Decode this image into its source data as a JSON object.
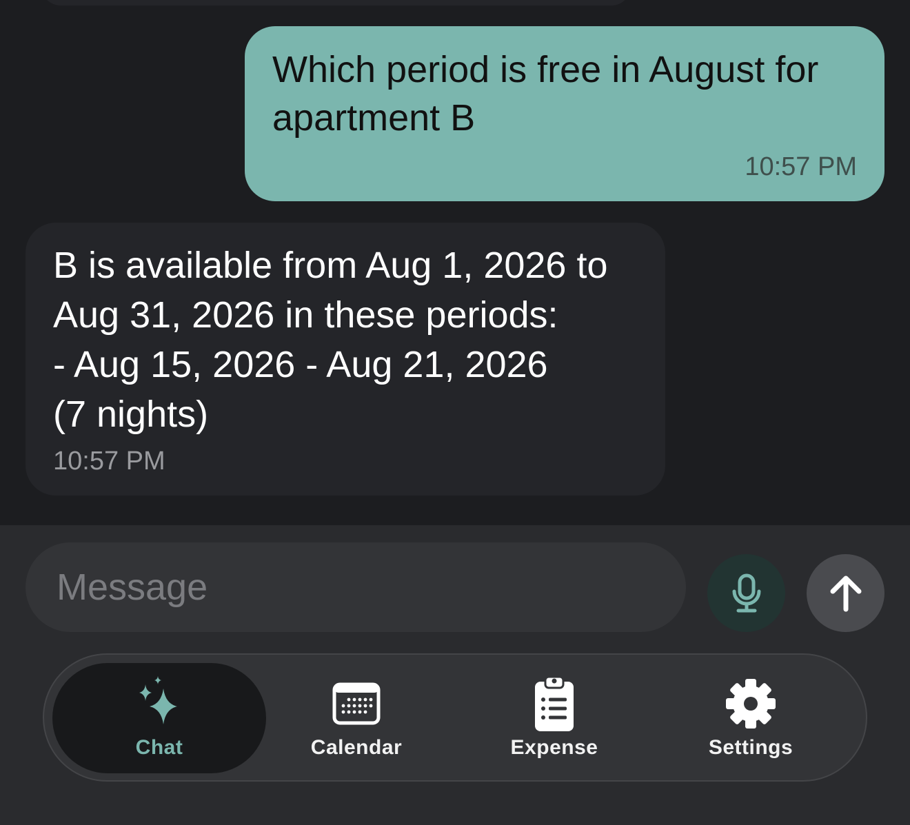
{
  "conversation": {
    "user_message": {
      "text": "Which period is free in August for apartment B",
      "time": "10:57 PM"
    },
    "assistant_message": {
      "text": "B is available from Aug 1, 2026 to\nAug 31, 2026 in these periods:\n- Aug 15, 2026 - Aug 21, 2026\n(7 nights)",
      "time": "10:57 PM"
    }
  },
  "composer": {
    "placeholder": "Message",
    "mic_icon": "microphone-icon",
    "send_icon": "arrow-up-icon"
  },
  "tabs": [
    {
      "label": "Chat",
      "icon": "sparkles-icon",
      "active": true
    },
    {
      "label": "Calendar",
      "icon": "calendar-icon",
      "active": false
    },
    {
      "label": "Expense",
      "icon": "clipboard-list-icon",
      "active": false
    },
    {
      "label": "Settings",
      "icon": "gear-icon",
      "active": false
    }
  ],
  "colors": {
    "accent": "#7bb6ae",
    "background": "#1c1d20",
    "bubble_assistant": "#242529"
  }
}
